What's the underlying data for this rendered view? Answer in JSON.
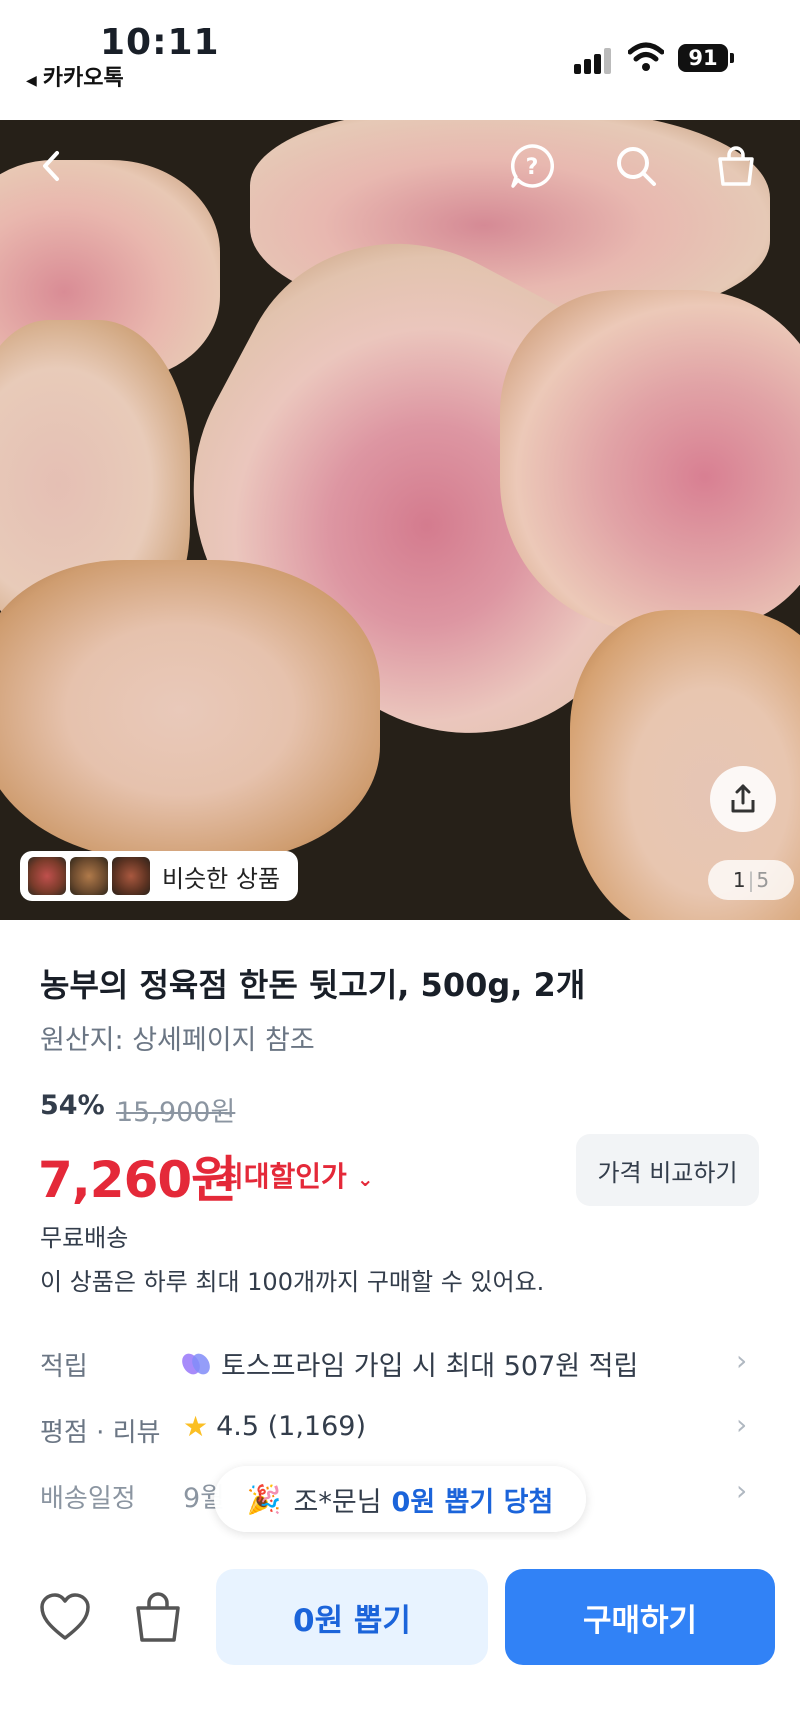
{
  "status_bar": {
    "time": "10:11",
    "back_app": "카카오톡",
    "battery": "91"
  },
  "hero": {
    "similar_label": "비슷한 상품",
    "pager_current": "1",
    "pager_total": "5",
    "icons": [
      "back-icon",
      "help-icon",
      "search-icon",
      "cart-icon",
      "share-icon"
    ]
  },
  "product": {
    "title": "농부의 정육점 한돈 뒷고기, 500g, 2개",
    "origin": "원산지: 상세페이지 참조",
    "discount_rate": "54%",
    "original_price": "15,900원",
    "price": "7,260원",
    "max_discount_label": "최대할인가",
    "compare_button": "가격 비교하기",
    "shipping": "무료배송",
    "purchase_limit": "이 상품은 하루 최대 100개까지 구매할 수 있어요."
  },
  "info_rows": [
    {
      "label": "적립",
      "value": "토스프라임 가입 시 최대 507원 적립"
    },
    {
      "label": "평점 · 리뷰",
      "value": "4.5 (1,169)"
    },
    {
      "label": "배송일정",
      "value": "9월"
    }
  ],
  "toast": {
    "prefix": "조*문님",
    "highlight": "0원 뽑기 당첨"
  },
  "bottom_bar": {
    "draw_button": "0원 뽑기",
    "buy_button": "구매하기"
  },
  "colors": {
    "price_red": "#e42939",
    "primary_blue": "#3182f6",
    "light_blue": "#e8f3ff",
    "star": "#fbbf24"
  }
}
